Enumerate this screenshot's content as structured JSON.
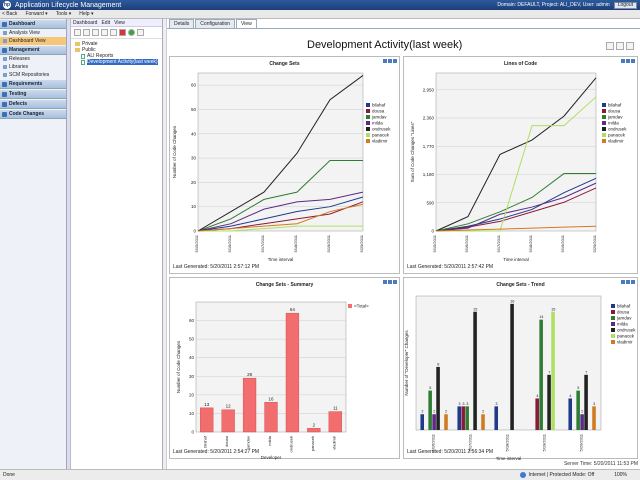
{
  "window": {
    "title": "Application Lifecycle Management",
    "domain_info": "Domain: DEFAULT, Project: ALI_DEV, User: admin",
    "logout_label": "Logout"
  },
  "menubar": {
    "items": [
      "< Back",
      "Forward ▾",
      "Tools ▾",
      "Help ▾"
    ]
  },
  "sidebar": {
    "sections": [
      {
        "label": "Dashboard",
        "items": [
          "Analysis View",
          "Dashboard View"
        ],
        "active": 1
      },
      {
        "label": "Management",
        "items": [
          "Releases",
          "Libraries",
          "SCM Repositories"
        ],
        "active": -1
      },
      {
        "label": "Requirements",
        "items": [],
        "active": -1
      },
      {
        "label": "Testing",
        "items": [],
        "active": -1
      },
      {
        "label": "Defects",
        "items": [],
        "active": -1
      },
      {
        "label": "Code Changes",
        "items": [],
        "active": -1
      }
    ]
  },
  "subnav": {
    "items": [
      "Dashboard",
      "Edit",
      "View"
    ]
  },
  "tree": {
    "nodes": [
      {
        "label": "Private",
        "type": "folder",
        "indent": 0
      },
      {
        "label": "Public",
        "type": "folder",
        "indent": 0
      },
      {
        "label": "ALI Reports",
        "type": "page",
        "indent": 1
      },
      {
        "label": "Development Activity(last week)",
        "type": "page",
        "indent": 1,
        "selected": true
      }
    ]
  },
  "tabs": {
    "items": [
      "Details",
      "Configuration",
      "View"
    ],
    "active": 2
  },
  "page_title": "Development Activity(last week)",
  "colors": {
    "bilahaf": "#1f3a8a",
    "dousa": "#8b1a3a",
    "jamdav": "#2e7d32",
    "milda": "#5b2a86",
    "ondrusek": "#222222",
    "panacek": "#aee060",
    "vladimir": "#d07b22",
    "total": "#f26d6d"
  },
  "panels": {
    "change_sets": {
      "generated": "Last Generated: 5/20/2011 2:57:12 PM"
    },
    "lines_of_code": {
      "generated": "Last Generated: 5/20/2011 2:57:42 PM"
    },
    "summary": {
      "generated": "Last Generated: 5/20/2011 2:54:27 PM"
    },
    "trend": {
      "generated": "Last Generated: 5/20/2011 2:56:34 PM"
    }
  },
  "chart_data": [
    {
      "type": "line",
      "title": "Change Sets",
      "xlabel": "Time interval",
      "ylabel": "Number of Code Changes",
      "categories": [
        "5/15/2011",
        "5/16/2011",
        "5/17/2011",
        "5/18/2011",
        "5/19/2011",
        "5/20/2011"
      ],
      "ylim": [
        0,
        65
      ],
      "yticks": [
        0,
        10,
        20,
        30,
        40,
        50,
        60
      ],
      "legend": "right",
      "series": [
        {
          "name": "bilahaf",
          "values": [
            0,
            2,
            5,
            8,
            10,
            14
          ]
        },
        {
          "name": "dousa",
          "values": [
            0,
            1,
            3,
            5,
            7,
            12
          ]
        },
        {
          "name": "jamdav",
          "values": [
            0,
            5,
            13,
            16,
            29,
            29
          ]
        },
        {
          "name": "milda",
          "values": [
            0,
            3,
            9,
            12,
            13,
            16
          ]
        },
        {
          "name": "ondrusek",
          "values": [
            0,
            8,
            16,
            32,
            54,
            64
          ]
        },
        {
          "name": "panacek",
          "values": [
            0,
            0,
            1,
            2,
            2,
            2
          ]
        },
        {
          "name": "vladimir",
          "values": [
            0,
            1,
            2,
            3,
            8,
            11
          ]
        }
      ]
    },
    {
      "type": "line",
      "title": "Lines of Code",
      "xlabel": "Time interval",
      "ylabel": "Sum of Code Changes \"Lines\"",
      "categories": [
        "5/15/2011",
        "5/16/2011",
        "5/17/2011",
        "5/18/2011",
        "5/19/2011",
        "5/20/2011"
      ],
      "ylim": [
        0,
        3300
      ],
      "yticks": [
        0,
        590,
        1180,
        1770,
        2360,
        2950
      ],
      "ytick_labels": [
        "0",
        "590",
        "1,180",
        "1,770",
        "2,360",
        "2,950"
      ],
      "legend": "right",
      "series": [
        {
          "name": "bilahaf",
          "values": [
            0,
            100,
            250,
            450,
            800,
            1100
          ]
        },
        {
          "name": "dousa",
          "values": [
            0,
            80,
            200,
            400,
            600,
            900
          ]
        },
        {
          "name": "jamdav",
          "values": [
            0,
            150,
            400,
            700,
            1200,
            1200
          ]
        },
        {
          "name": "milda",
          "values": [
            0,
            60,
            350,
            500,
            700,
            1000
          ]
        },
        {
          "name": "ondrusek",
          "values": [
            0,
            300,
            1600,
            1900,
            2400,
            3200
          ]
        },
        {
          "name": "panacek",
          "values": [
            0,
            0,
            0,
            2200,
            2200,
            2800
          ]
        },
        {
          "name": "vladimir",
          "values": [
            0,
            20,
            40,
            60,
            80,
            100
          ]
        }
      ]
    },
    {
      "type": "bar",
      "title": "Change Sets - Summary",
      "xlabel": "Developer",
      "ylabel": "Number of Code Changes",
      "categories": [
        "bilahaf",
        "dousa",
        "jamdav",
        "milda",
        "ondrusek",
        "panacek",
        "vladimir"
      ],
      "values": [
        13,
        12,
        29,
        16,
        64,
        2,
        11
      ],
      "ylim": [
        0,
        70
      ],
      "yticks": [
        0,
        10,
        20,
        30,
        40,
        50,
        60
      ],
      "legend_label": "<Total>"
    },
    {
      "type": "bar",
      "title": "Change Sets - Trend",
      "xlabel": "Time interval",
      "ylabel": "Number of \"Developer\" Changes",
      "categories": [
        "5/16/2011",
        "5/17/2011",
        "5/18/2011",
        "5/19/2011",
        "5/20/2011"
      ],
      "ylim": [
        0,
        17
      ],
      "series": [
        {
          "name": "bilahaf",
          "values": [
            2,
            3,
            3,
            0,
            4
          ]
        },
        {
          "name": "dousa",
          "values": [
            0,
            3,
            0,
            4,
            0
          ]
        },
        {
          "name": "jamdav",
          "values": [
            5,
            3,
            0,
            14,
            5
          ]
        },
        {
          "name": "milda",
          "values": [
            2,
            0,
            0,
            0,
            2
          ]
        },
        {
          "name": "ondrusek",
          "values": [
            8,
            15,
            16,
            7,
            7
          ]
        },
        {
          "name": "panacek",
          "values": [
            0,
            0,
            0,
            15,
            0
          ]
        },
        {
          "name": "vladimir",
          "values": [
            2,
            2,
            0,
            0,
            3
          ]
        }
      ]
    }
  ],
  "statusbar": {
    "left": "Done",
    "zone": "Internet | Protected Mode: Off",
    "zoom": "100%",
    "server_time": "Server Time: 5/20/2011 11:53 PM"
  }
}
